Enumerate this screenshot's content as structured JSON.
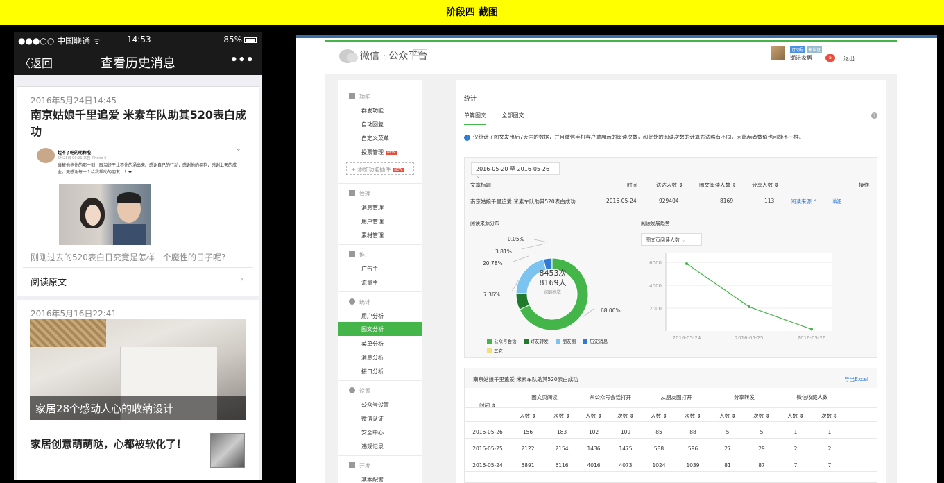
{
  "banner": "阶段四 截图",
  "phone": {
    "status": {
      "carrier": "●●●○○ 中国联通 ᯤ",
      "time": "14:53",
      "battery": "85%"
    },
    "nav": {
      "back": "〈返回",
      "title": "查看历史消息",
      "more": "•••"
    },
    "card1": {
      "date": "2016年5月24日14:45",
      "title": "南京姑娘千里追爱 米素车队助其520表白成功",
      "comment_user": "起不了吧的昵称啦",
      "comment_meta": "5月28日 09:21 来自 iPhone 6",
      "comment_text": "当被他拖住的那一刻，眼泪终于止不住的涌出来。感谢自己的行动，感谢他的拥抱，感谢上天的成全，更感谢每一个给我帮助的朋友！！❤",
      "desc": "刚刚过去的520表白日究竟是怎样一个魔性的日子呢?",
      "read_more": "阅读原文"
    },
    "card2": {
      "date": "2016年5月16日22:41",
      "caption": "家居28个感动人心的收纳设计",
      "title2": "家居创意萌萌哒，心都被软化了！"
    }
  },
  "mp": {
    "brand": "微信 · 公众平台",
    "brand_tag": "beta",
    "badge1": "订阅号",
    "badge2": "未认证",
    "account": "潮流家居",
    "msg_count": "5",
    "logout": "退出",
    "sidebar": {
      "g1": "功能",
      "g1_items": [
        "群发功能",
        "自动回复",
        "自定义菜单",
        "投票管理"
      ],
      "new_tag": "NEW",
      "add_plugin": "+ 添加功能插件",
      "g2": "管理",
      "g2_items": [
        "消息管理",
        "用户管理",
        "素材管理"
      ],
      "g3": "推广",
      "g3_items": [
        "广告主",
        "流量主"
      ],
      "g4": "统计",
      "g4_items": [
        "用户分析",
        "图文分析",
        "菜单分析",
        "消息分析",
        "接口分析"
      ],
      "g5": "设置",
      "g5_items": [
        "公众号设置",
        "微信认证",
        "安全中心",
        "违规记录"
      ],
      "g6": "开发",
      "g6_items": [
        "基本配置"
      ]
    },
    "main": {
      "title": "统计",
      "tab1": "单篇图文",
      "tab2": "全部图文",
      "info": "仅统计了图文发出后7天内的数据，并且微信手机客户端展示的阅读次数，和此处的阅读次数的计算方法略有不同，因此两者数值也可能不一样。",
      "date_range": "2016-05-20 至 2016-05-26",
      "thead": [
        "文章标题",
        "时间",
        "送达人数 ⇕",
        "图文阅读人数 ⇕",
        "分享人数 ⇕",
        "操作"
      ],
      "row": {
        "title": "南京姑娘千里追爱 米素车队助其520表白成功",
        "date": "2016-05-24",
        "sent": "929404",
        "readers": "8169",
        "shares": "113",
        "op1": "阅读来源 ⌃",
        "op2": "详细"
      },
      "src_title": "阅读来源分布",
      "trend_title": "阅读发展趋势",
      "metric": "图文页阅读人数",
      "donut_center1": "8453次",
      "donut_center2": "8169人",
      "donut_center3": "阅读总数",
      "legend": [
        "公众号会话",
        "好友转发",
        "朋友圈",
        "历史消息",
        "其它"
      ],
      "pcts": [
        "0.05%",
        "3.81%",
        "20.78%",
        "7.36%",
        "68.00%"
      ],
      "detail_title": "南京姑娘千里追爱 米素车队助其520表白成功",
      "export": "导出Excel",
      "group_headers": [
        "图文页阅读",
        "从公众号会话打开",
        "从朋友圈打开",
        "分享转发",
        "微信收藏人数"
      ],
      "time_col": "时间 ⇕",
      "sub_headers": [
        "人数 ⇕",
        "次数 ⇕"
      ],
      "rows": [
        [
          "2016-05-26",
          "156",
          "183",
          "102",
          "109",
          "85",
          "88",
          "5",
          "5",
          "1",
          "1"
        ],
        [
          "2016-05-25",
          "2122",
          "2154",
          "1436",
          "1475",
          "588",
          "596",
          "27",
          "29",
          "2",
          "2"
        ],
        [
          "2016-05-24",
          "5891",
          "6116",
          "4016",
          "4073",
          "1024",
          "1039",
          "81",
          "87",
          "7",
          "7"
        ]
      ]
    }
  },
  "chart_data": [
    {
      "type": "pie",
      "title": "阅读来源分布",
      "categories": [
        "公众号会话",
        "好友转发",
        "朋友圈",
        "历史消息",
        "其它"
      ],
      "values": [
        68.0,
        7.36,
        20.78,
        3.81,
        0.05
      ],
      "colors": [
        "#44b549",
        "#1f7a2c",
        "#7cc4ef",
        "#2f7bd3",
        "#f1e07a"
      ]
    },
    {
      "type": "line",
      "title": "阅读发展趋势",
      "x": [
        "2016-05-24",
        "2016-05-25",
        "2016-05-26"
      ],
      "series": [
        {
          "name": "图文页阅读人数",
          "values": [
            5891,
            2122,
            156
          ]
        }
      ],
      "yticks": [
        "6000",
        "4000",
        "2000"
      ],
      "ylim": [
        0,
        6800
      ]
    }
  ]
}
